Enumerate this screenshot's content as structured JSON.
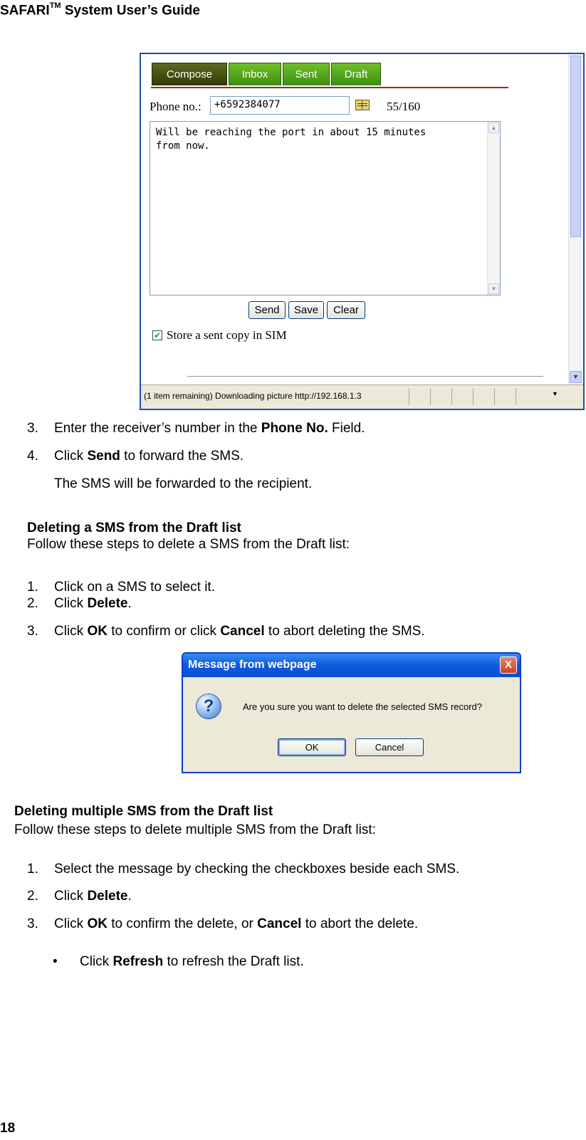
{
  "header": {
    "title": "SAFARI",
    "tm": "TM",
    "rest": " System User’s Guide"
  },
  "page_number": "18",
  "compose_screenshot": {
    "tabs": [
      "Compose",
      "Inbox",
      "Sent",
      "Draft"
    ],
    "phone_label": "Phone no.:",
    "phone_value": "+6592384077",
    "counter": "55/160",
    "message": "Will be reaching the port in about 15 minutes\nfrom now.",
    "buttons": {
      "send": "Send",
      "save": "Save",
      "clear": "Clear"
    },
    "store_checkbox_label": "Store a sent copy in SIM",
    "status_text": "(1 item remaining) Downloading picture http://192.168.1.3"
  },
  "steps_a": [
    {
      "num": "3.",
      "pre": "Enter the receiver’s number in the ",
      "bold": "Phone No.",
      "post": " Field."
    },
    {
      "num": "4.",
      "pre": "Click ",
      "bold": "Send",
      "post": " to forward the SMS."
    }
  ],
  "note_a": "The SMS will be forwarded to the recipient.",
  "section1": {
    "heading": "Deleting a SMS from the Draft list",
    "intro": "Follow these steps to delete a SMS from the Draft list:",
    "step1": {
      "num": "1.",
      "text": "Click on a SMS to select it."
    },
    "step2": {
      "num": "2.",
      "pre": "Click ",
      "bold": "Delete",
      "post": "."
    },
    "step3": {
      "num": "3.",
      "pre": "Click ",
      "bold": "OK",
      "mid": " to confirm or click ",
      "bold2": "Cancel",
      "post": " to abort deleting the SMS."
    }
  },
  "dialog": {
    "title": "Message from webpage",
    "close": "X",
    "message": "Are you sure you want to delete the selected SMS record?",
    "ok": "OK",
    "cancel": "Cancel"
  },
  "section2": {
    "heading": "Deleting multiple SMS from the Draft list",
    "intro": "Follow these steps to delete multiple SMS from the Draft list:",
    "step1": {
      "num": "1.",
      "text": "Select the message by checking the checkboxes beside each SMS."
    },
    "step2": {
      "num": "2.",
      "pre": "Click ",
      "bold": "Delete",
      "post": "."
    },
    "step3": {
      "num": "3.",
      "pre": "Click ",
      "bold": "OK",
      "mid": " to confirm the delete, or ",
      "bold2": "Cancel",
      "post": " to abort the delete."
    },
    "bullet": {
      "symbol": "•",
      "pre": "Click ",
      "bold": "Refresh",
      "post": " to refresh the Draft list."
    }
  }
}
